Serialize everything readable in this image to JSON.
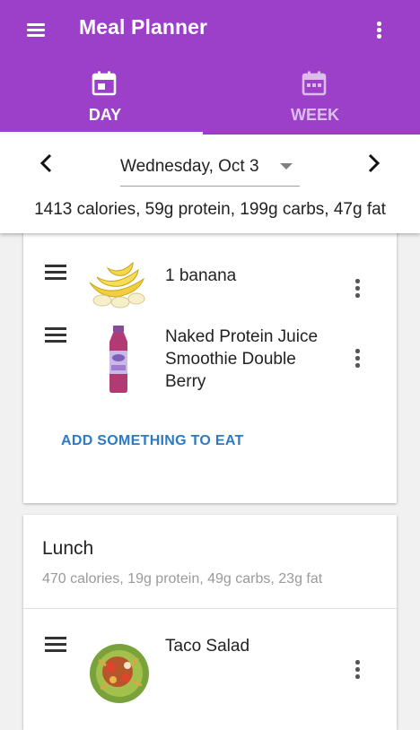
{
  "app": {
    "title": "Meal Planner",
    "colors": {
      "primary": "#9c3fc9",
      "accent_link": "#2c7ac4"
    }
  },
  "tabs": [
    {
      "label": "DAY",
      "icon": "calendar-day-icon",
      "selected": true
    },
    {
      "label": "WEEK",
      "icon": "calendar-week-icon",
      "selected": false
    }
  ],
  "date_bar": {
    "selected_date": "Wednesday, Oct 3",
    "summary": "1413 calories, 59g protein, 199g carbs, 47g fat"
  },
  "meals": [
    {
      "name": "",
      "items": [
        {
          "name": "1 banana",
          "image": "banana-image"
        },
        {
          "name": "Naked Protein Juice Smoothie Double Berry",
          "image": "smoothie-bottle-image"
        }
      ],
      "add_label": "ADD SOMETHING TO EAT"
    },
    {
      "name": "Lunch",
      "summary": "470 calories, 19g protein, 49g carbs, 23g fat",
      "items": [
        {
          "name": "Taco Salad",
          "image": "taco-salad-image"
        }
      ]
    }
  ]
}
